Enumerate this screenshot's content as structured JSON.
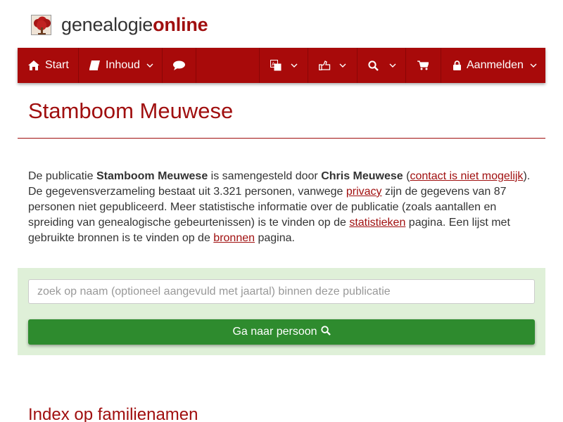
{
  "header": {
    "brand_light": "genealogie",
    "brand_bold": "online"
  },
  "nav": {
    "start_label": "Start",
    "inhoud_label": "Inhoud",
    "login_label": "Aanmelden",
    "icons": [
      "home-icon",
      "book-icon",
      "chat-icon",
      "translate-icon",
      "thumbs-up-icon",
      "search-icon",
      "cart-icon",
      "lock-icon"
    ]
  },
  "page": {
    "title": "Stamboom Meuwese"
  },
  "intro": {
    "t1": "De publicatie ",
    "publication_name": "Stamboom Meuwese",
    "t2": " is samengesteld door ",
    "author": "Chris Meuwese",
    "t3": " (",
    "contact_link": "contact is niet mogelijk",
    "t4": "). De gegevensverzameling bestaat uit 3.321 personen, vanwege ",
    "privacy_link": "privacy",
    "t5": " zijn de gegevens van 87 personen niet gepubliceerd. Meer statistische informatie over de publicatie (zoals aantallen en spreiding van genealogische gebeurtenissen) is te vinden op de ",
    "stats_link": "statistieken",
    "t6": " pagina. Een lijst met gebruikte bronnen is te vinden op de ",
    "sources_link": "bronnen",
    "t7": " pagina."
  },
  "search": {
    "placeholder": "zoek op naam (optioneel aangevuld met jaartal) binnen deze publicatie",
    "value": "",
    "button_label": "Ga naar persoon"
  },
  "index": {
    "title": "Index op familienamen"
  },
  "colors": {
    "brand_red": "#a00f0f",
    "nav_bg": "#a80a0a",
    "panel_bg": "#dff0d8",
    "button_green": "#2e8b2e"
  }
}
